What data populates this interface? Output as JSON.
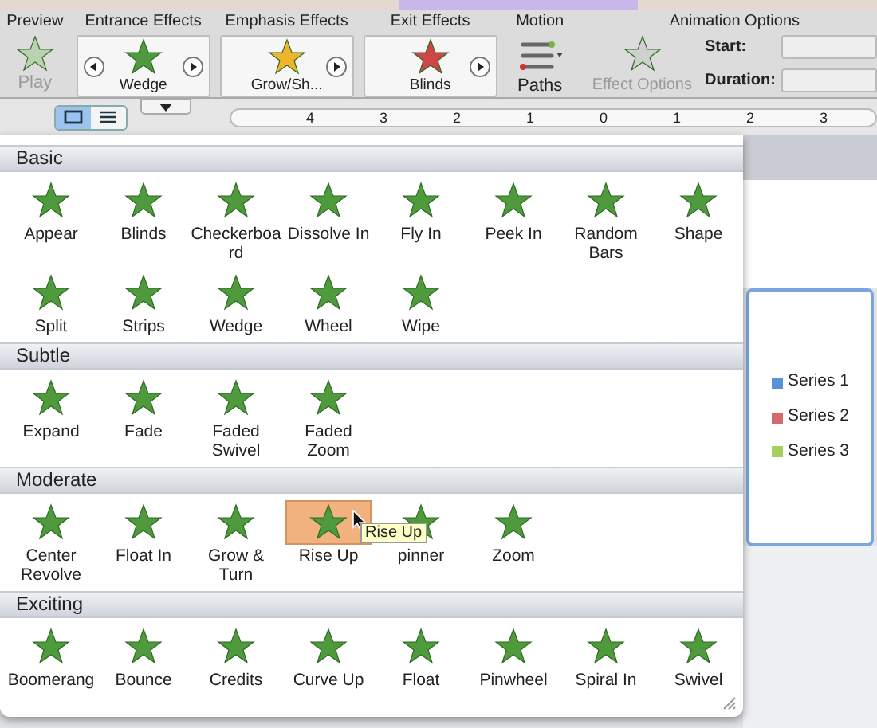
{
  "ribbon": {
    "groups": [
      {
        "kind": "preview",
        "title": "Preview",
        "label": "Play",
        "disabled": true
      },
      {
        "kind": "gallery",
        "title": "Entrance Effects",
        "label": "Wedge",
        "has_prev": true,
        "color": "#4f9a3c"
      },
      {
        "kind": "gallery",
        "title": "Emphasis Effects",
        "label": "Grow/Sh...",
        "has_prev": false,
        "color": "#f0b429"
      },
      {
        "kind": "gallery",
        "title": "Exit Effects",
        "label": "Blinds",
        "has_prev": false,
        "color": "#d04545"
      },
      {
        "kind": "motion",
        "title": "Motion",
        "label": "Paths"
      },
      {
        "kind": "options",
        "title": "Animation Options",
        "label": "Effect Options",
        "disabled": true,
        "fields": [
          "Start:",
          "Duration:"
        ]
      }
    ]
  },
  "view_buttons": [
    {
      "selected": true
    },
    {
      "selected": false
    }
  ],
  "ruler": [
    "4",
    "3",
    "2",
    "1",
    "0",
    "1",
    "2",
    "3"
  ],
  "gallery": {
    "sections": [
      {
        "title": "Basic",
        "items": [
          {
            "label": "Appear",
            "selected": false
          },
          {
            "label": "Blinds",
            "selected": false
          },
          {
            "label": "Checkerboard",
            "selected": false
          },
          {
            "label": "Dissolve In",
            "selected": false
          },
          {
            "label": "Fly In",
            "selected": false
          },
          {
            "label": "Peek In",
            "selected": false
          },
          {
            "label": "Random Bars",
            "selected": false
          },
          {
            "label": "Shape",
            "selected": false
          },
          {
            "label": "Split",
            "selected": false
          },
          {
            "label": "Strips",
            "selected": false
          },
          {
            "label": "Wedge",
            "selected": false
          },
          {
            "label": "Wheel",
            "selected": false
          },
          {
            "label": "Wipe",
            "selected": false
          }
        ]
      },
      {
        "title": "Subtle",
        "items": [
          {
            "label": "Expand",
            "selected": false
          },
          {
            "label": "Fade",
            "selected": false
          },
          {
            "label": "Faded Swivel",
            "selected": false
          },
          {
            "label": "Faded Zoom",
            "selected": false
          }
        ]
      },
      {
        "title": "Moderate",
        "items": [
          {
            "label": "Center Revolve",
            "selected": false
          },
          {
            "label": "Float In",
            "selected": false
          },
          {
            "label": "Grow & Turn",
            "selected": false
          },
          {
            "label": "Rise Up",
            "selected": true
          },
          {
            "label": "pinner",
            "selected": false
          },
          {
            "label": "Zoom",
            "selected": false
          }
        ]
      },
      {
        "title": "Exciting",
        "items": [
          {
            "label": "Boomerang",
            "selected": false
          },
          {
            "label": "Bounce",
            "selected": false
          },
          {
            "label": "Credits",
            "selected": false
          },
          {
            "label": "Curve Up",
            "selected": false
          },
          {
            "label": "Float",
            "selected": false
          },
          {
            "label": "Pinwheel",
            "selected": false
          },
          {
            "label": "Spiral In",
            "selected": false
          },
          {
            "label": "Swivel",
            "selected": false
          }
        ]
      }
    ],
    "tooltip": "Rise Up"
  },
  "legend": [
    {
      "label": "Series 1",
      "color": "#5b8fd6"
    },
    {
      "label": "Series 2",
      "color": "#d46a6a"
    },
    {
      "label": "Series 3",
      "color": "#a6cf5b"
    }
  ]
}
